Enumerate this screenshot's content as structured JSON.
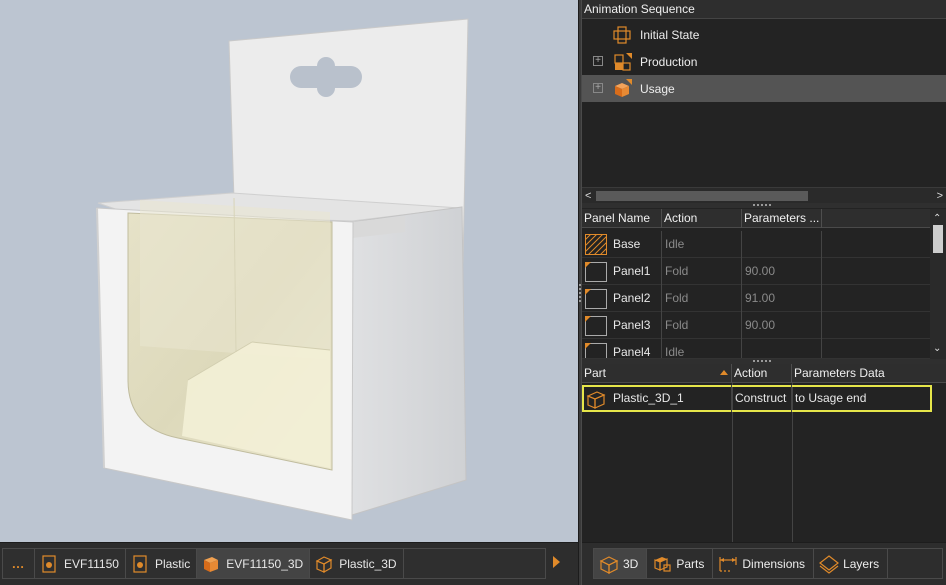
{
  "doc_tabs": {
    "more": "…",
    "items": [
      {
        "label": "EVF11150",
        "icon": "document-icon"
      },
      {
        "label": "Plastic",
        "icon": "document-icon"
      },
      {
        "label": "EVF11150_3D",
        "icon": "box-3d-icon",
        "active": true
      },
      {
        "label": "Plastic_3D",
        "icon": "plastic-3d-icon"
      }
    ]
  },
  "animation": {
    "title": "Animation Sequence",
    "items": [
      {
        "label": "Initial State",
        "icon": "initial-state-icon",
        "expandable": false
      },
      {
        "label": "Production",
        "icon": "production-icon",
        "expandable": true
      },
      {
        "label": "Usage",
        "icon": "usage-box-icon",
        "expandable": true,
        "selected": true
      }
    ]
  },
  "panel_table": {
    "columns": [
      "Panel Name",
      "Action",
      "Parameters ..."
    ],
    "rows": [
      {
        "name": "Base",
        "action": "Idle",
        "param": ""
      },
      {
        "name": "Panel1",
        "action": "Fold",
        "param": "90.00"
      },
      {
        "name": "Panel2",
        "action": "Fold",
        "param": "91.00"
      },
      {
        "name": "Panel3",
        "action": "Fold",
        "param": "90.00"
      },
      {
        "name": "Panel4",
        "action": "Idle",
        "param": ""
      }
    ]
  },
  "part_table": {
    "columns": [
      "Part",
      "Action",
      "Parameters Data"
    ],
    "rows": [
      {
        "part": "Plastic_3D_1",
        "action": "Construct",
        "param": "to Usage end",
        "highlighted": true
      }
    ]
  },
  "view_tabs": [
    {
      "label": "3D",
      "icon": "cube-3d-icon",
      "active": true
    },
    {
      "label": "Parts",
      "icon": "parts-icon"
    },
    {
      "label": "Dimensions",
      "icon": "dimensions-icon"
    },
    {
      "label": "Layers",
      "icon": "layers-icon"
    }
  ],
  "colors": {
    "accent": "#e08a2a",
    "viewport_bg": "#bcc5d1",
    "selection": "#545454",
    "highlight": "#e6e64a"
  }
}
